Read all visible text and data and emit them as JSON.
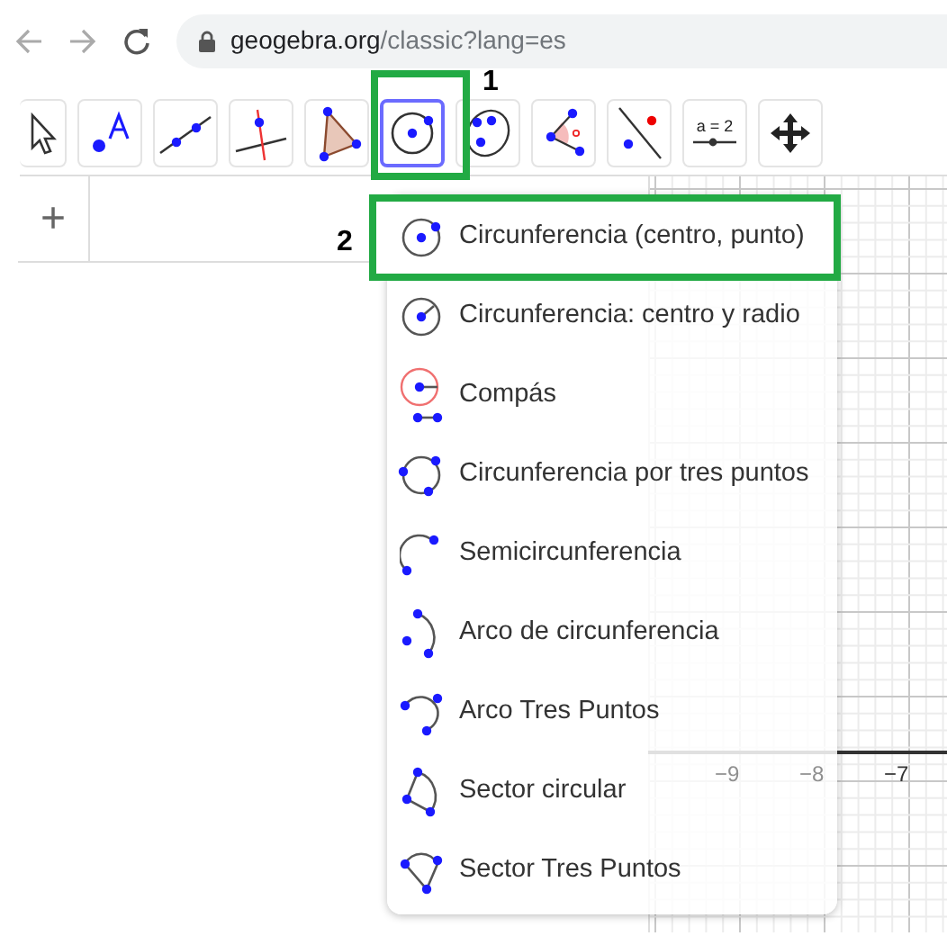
{
  "browser": {
    "url_host": "geogebra.org",
    "url_path": "/classic?lang=es"
  },
  "toolbar": {
    "tools": [
      {
        "kind": "move",
        "selected": false
      },
      {
        "kind": "point",
        "selected": false
      },
      {
        "kind": "line",
        "selected": false
      },
      {
        "kind": "perpendicular",
        "selected": false
      },
      {
        "kind": "polygon",
        "selected": false
      },
      {
        "kind": "circle",
        "selected": true
      },
      {
        "kind": "ellipse",
        "selected": false
      },
      {
        "kind": "angle",
        "selected": false
      },
      {
        "kind": "reflect",
        "selected": false
      },
      {
        "kind": "slider",
        "selected": false,
        "label": "a = 2"
      },
      {
        "kind": "pan",
        "selected": false
      }
    ]
  },
  "annotations": [
    "1",
    "2"
  ],
  "algebra": {
    "add_symbol": "+"
  },
  "menu": {
    "items": [
      {
        "kind": "circle",
        "label": "Circunferencia (centro, punto)",
        "selected": true
      },
      {
        "kind": "radius",
        "label": "Circunferencia: centro y radio",
        "selected": false
      },
      {
        "kind": "compass",
        "label": "Compás",
        "selected": false
      },
      {
        "kind": "three",
        "label": "Circunferencia por tres puntos",
        "selected": false
      },
      {
        "kind": "semi",
        "label": "Semicircunferencia",
        "selected": false
      },
      {
        "kind": "arc",
        "label": "Arco de circunferencia",
        "selected": false
      },
      {
        "kind": "arc3",
        "label": "Arco Tres Puntos",
        "selected": false
      },
      {
        "kind": "sector",
        "label": "Sector circular",
        "selected": false
      },
      {
        "kind": "sector3",
        "label": "Sector Tres Puntos",
        "selected": false
      }
    ]
  },
  "graphics": {
    "x_labels": [
      "−9",
      "−8",
      "−7"
    ]
  }
}
